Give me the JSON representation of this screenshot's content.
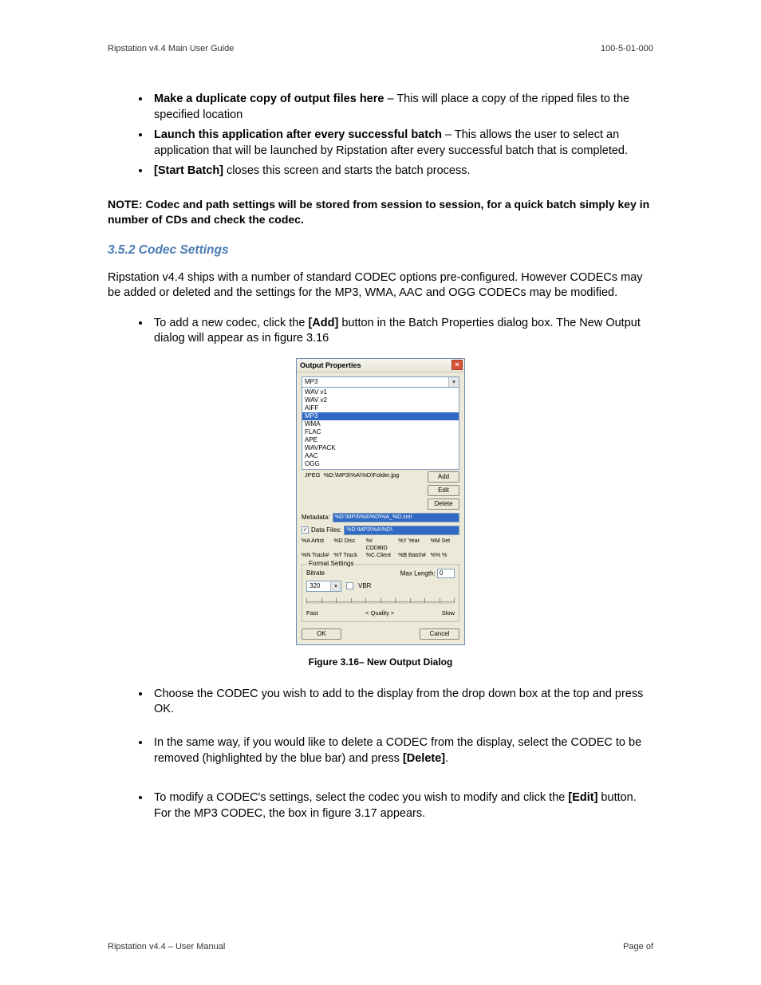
{
  "header": {
    "left": "Ripstation v4.4 Main User Guide",
    "right": "100-5-01-000"
  },
  "top_bullets": [
    {
      "bold": "Make a duplicate copy of output files here",
      "rest": " – This will place a copy of the ripped files to the specified location"
    },
    {
      "bold": "Launch this application after every successful batch",
      "rest": " – This allows the user to select an application that will be launched by Ripstation after every successful batch that is completed."
    },
    {
      "bold": "[Start Batch]",
      "rest": " closes this screen and starts the batch process."
    }
  ],
  "note": "NOTE: Codec and path settings will be stored from session to session, for a quick batch simply key in number of CDs and check the codec.",
  "section_heading": "3.5.2 Codec Settings",
  "para1": "Ripstation v4.4 ships with a number of standard CODEC options pre-configured. However CODECs may be added or deleted and the settings for the MP3, WMA, AAC and OGG CODECs may be modified.",
  "mid_bullets": [
    {
      "pre": "To add a new codec, click the ",
      "bold": "[Add]",
      "post": " button in the Batch Properties dialog box. The New Output dialog will appear as in figure 3.16"
    }
  ],
  "dialog": {
    "title": "Output Properties",
    "dropdown_selected": "MP3",
    "codec_options": [
      "WAV v1",
      "WAV v2",
      "AIFF",
      "MP3",
      "WMA",
      "FLAC",
      "APE",
      "WAVPACK",
      "AAC",
      "OGG"
    ],
    "selected_codec": "MP3",
    "jpeg_label": "JPEG",
    "jpeg_path": "%D:\\MP3\\%A\\%D\\Folder.jpg",
    "buttons": {
      "add": "Add",
      "edit": "Edit",
      "del": "Delete"
    },
    "metadata_label": "Metadata:",
    "metadata_value": "%D:\\MP3\\%A\\%D\\%A_%D.xml",
    "datafiles_label": "Data Files:",
    "datafiles_value": "%D:\\MP3\\%A\\%D\\",
    "tokens_row1": [
      "%A Artist",
      "%D Disc",
      "%I CDDBID",
      "%Y Year",
      "%M Set"
    ],
    "tokens_row2": [
      "%N Track#",
      "%T Track",
      "%C Client",
      "%B Batch#",
      "%% %"
    ],
    "format_legend": "Format Settings",
    "bitrate_label": "Bitrate",
    "maxlen_label": "Max Length:",
    "maxlen_value": "0",
    "bitrate_value": "320",
    "vbr_label": "VBR",
    "slider_fast": "Fast",
    "slider_quality": "<   Quality   >",
    "slider_slow": "Slow",
    "ok": "OK",
    "cancel": "Cancel"
  },
  "figure_caption": "Figure 3.16– New Output Dialog",
  "bottom_bullets": [
    {
      "text": "Choose the CODEC you wish to add to the display from the drop down box at the top and press OK."
    },
    {
      "pre": "In the same way, if you would like to delete a CODEC from the display, select the CODEC to be removed (highlighted by the blue bar) and press ",
      "bold": "[Delete]",
      "post": "."
    },
    {
      "pre": "To modify a CODEC's settings, select the codec you wish to modify and click the ",
      "bold": "[Edit]",
      "post": " button.  For the MP3 CODEC, the box in figure 3.17 appears."
    }
  ],
  "footer": {
    "left": "Ripstation v4.4 – User Manual",
    "right": "Page    of"
  }
}
